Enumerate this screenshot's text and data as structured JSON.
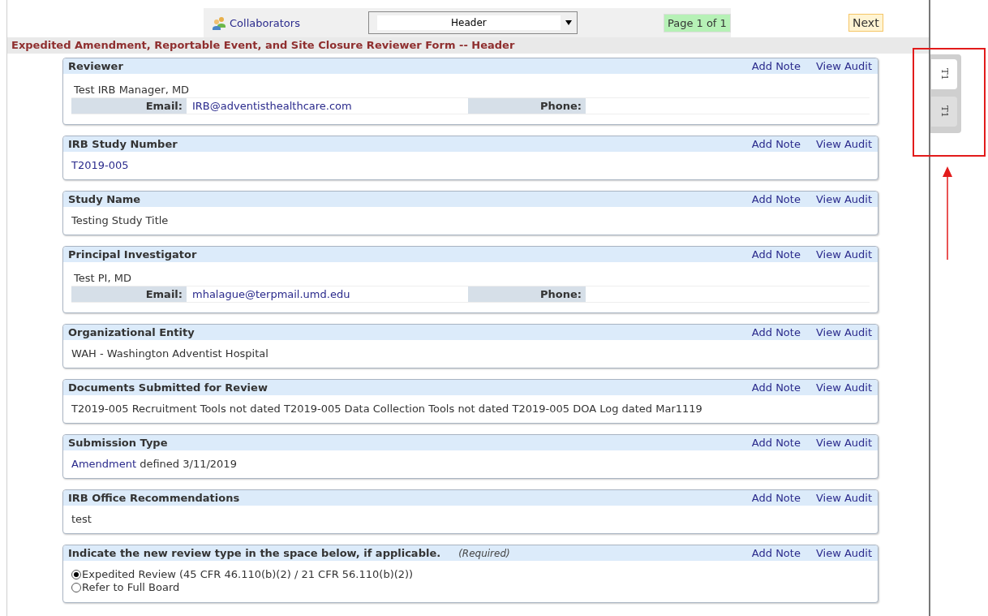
{
  "toolbar": {
    "collaborators": "Collaborators",
    "page_select": "Header",
    "page_indicator": "Page 1 of 1",
    "next": "Next"
  },
  "form_title": "Expedited Amendment, Reportable Event, and Site Closure Reviewer Form -- Header",
  "sections": [
    {
      "kind": "person",
      "title": "Reviewer",
      "actions": [
        "Add Note",
        "View Audit"
      ],
      "name": "Test IRB Manager, MD",
      "email_label": "Email:",
      "email": "IRB@adventisthealthcare.com",
      "phone_label": "Phone:"
    },
    {
      "kind": "link",
      "title": "IRB Study Number",
      "actions": [
        "Add Note",
        "View Audit"
      ],
      "value": "T2019-005"
    },
    {
      "kind": "text",
      "title": "Study Name",
      "actions": [
        "Add Note",
        "View Audit"
      ],
      "value": "Testing Study Title"
    },
    {
      "kind": "person",
      "title": "Principal Investigator",
      "actions": [
        "Add Note",
        "View Audit"
      ],
      "name": "Test PI, MD",
      "email_label": "Email:",
      "email": "mhalague@terpmail.umd.edu",
      "phone_label": "Phone:"
    },
    {
      "kind": "text",
      "title": "Organizational Entity",
      "actions": [
        "Add Note",
        "View Audit"
      ],
      "value": "WAH - Washington Adventist Hospital"
    },
    {
      "kind": "text",
      "title": "Documents Submitted for Review",
      "actions": [
        "Add Note",
        "View Audit"
      ],
      "value": "T2019-005 Recruitment Tools not dated T2019-005 Data Collection Tools not dated T2019-005 DOA Log dated Mar1119"
    },
    {
      "kind": "linktext",
      "title": "Submission Type",
      "actions": [
        "Add Note",
        "View Audit"
      ],
      "value": "Amendment",
      "text": "defined 3/11/2019"
    },
    {
      "kind": "text",
      "title": "IRB Office Recommendations",
      "actions": [
        "Add Note",
        "View Audit"
      ],
      "value": "test"
    },
    {
      "kind": "radio",
      "title": "Indicate the new review type in the space below, if applicable.",
      "required": "(Required)",
      "actions": [
        "Add Note",
        "View Audit"
      ],
      "options": [
        {
          "label": "Expedited Review (45 CFR 46.110(b)(2) / 21 CFR 56.110(b)(2))",
          "selected": true
        },
        {
          "label": "Refer to Full Board",
          "selected": false
        }
      ]
    }
  ],
  "side_tabs": [
    {
      "label": "T1",
      "selected": true
    },
    {
      "label": "T1",
      "selected": false
    }
  ]
}
